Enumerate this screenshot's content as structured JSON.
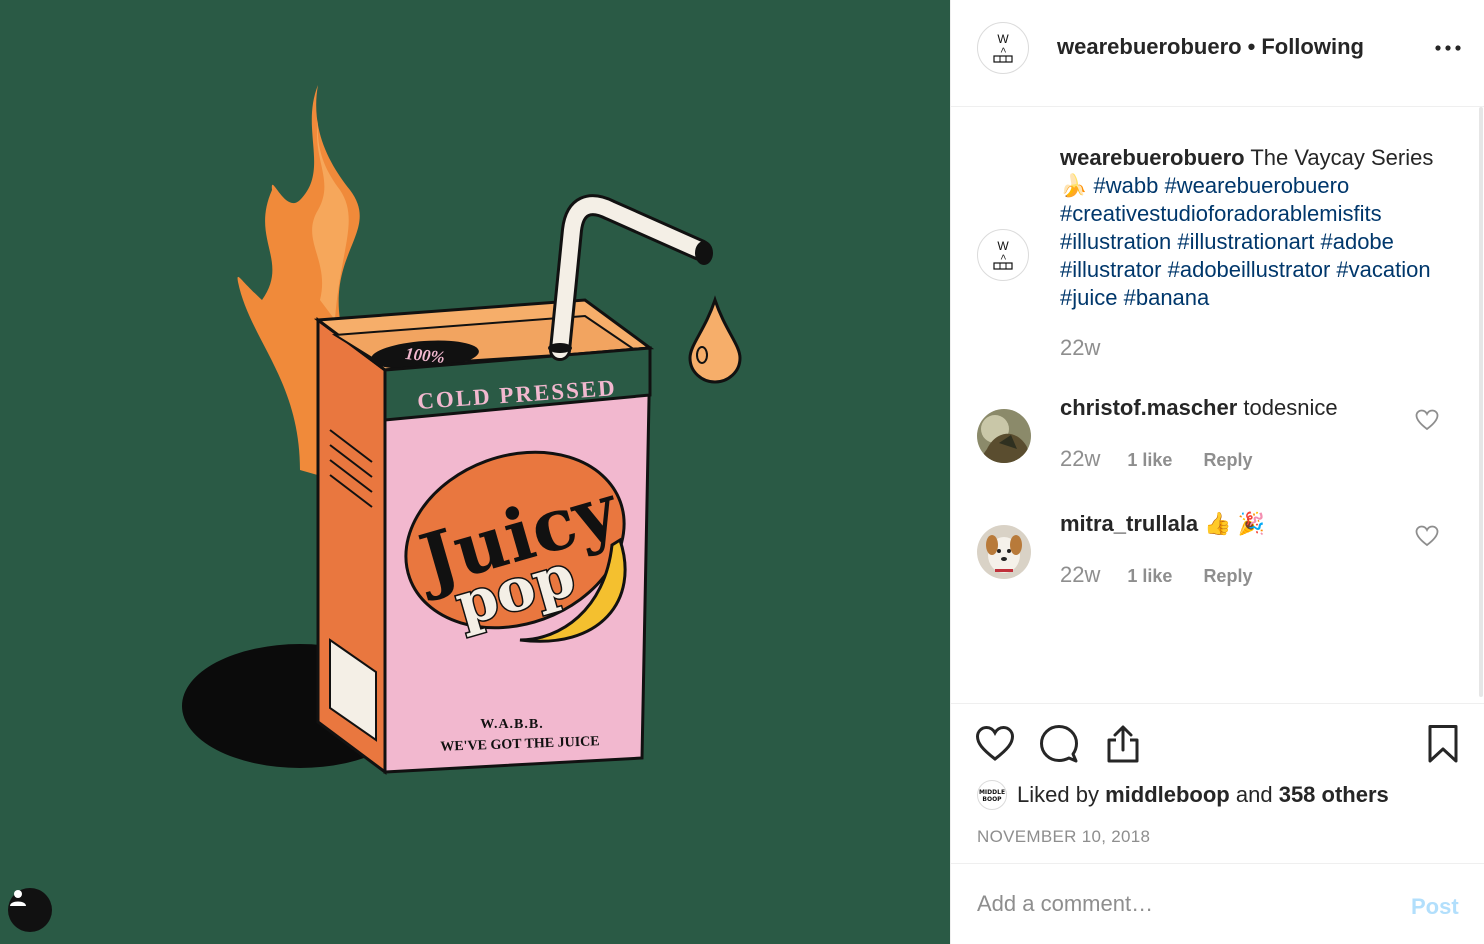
{
  "post_image": {
    "box_label_100": "100%",
    "box_label_cold_pressed": "COLD PRESSED",
    "brand_line1": "Juicy",
    "brand_line2": "pop",
    "maker": "W.A.B.B.",
    "slogan": "WE'VE GOT THE JUICE",
    "colors": {
      "background": "#2a5a45",
      "box_pink": "#f2b8cf",
      "box_orange": "#e9773f",
      "flame": "#f08a3a",
      "banana": "#f4c02f"
    }
  },
  "header": {
    "username": "wearebuerobuero",
    "separator": "•",
    "follow_status": "Following",
    "avatar_text": "W"
  },
  "caption": {
    "username": "wearebuerobuero",
    "text_before": "The Vaycay Series 🍌",
    "hashtags": [
      "#wabb",
      "#wearebuerobuero",
      "#creativestudioforadorablemisfits",
      "#illustration",
      "#illustrationart",
      "#adobe",
      "#illustrator",
      "#adobeillustrator",
      "#vacation",
      "#juice",
      "#banana"
    ],
    "time": "22w"
  },
  "comments": [
    {
      "username": "christof.mascher",
      "text": "todesnice",
      "time": "22w",
      "likes": "1 like",
      "reply": "Reply"
    },
    {
      "username": "mitra_trullala",
      "text": "👍 🎉",
      "time": "22w",
      "likes": "1 like",
      "reply": "Reply"
    }
  ],
  "actions": {
    "liked_by_prefix": "Liked by",
    "liked_by_user": "middleboop",
    "liked_by_and": "and",
    "liked_by_others": "358 others",
    "liker_avatar_text": "MIDDLE BOOP",
    "date": "NOVEMBER 10, 2018",
    "icons": [
      "heart-icon",
      "comment-icon",
      "share-icon",
      "bookmark-icon"
    ]
  },
  "add_comment": {
    "placeholder": "Add a comment…",
    "post_label": "Post"
  }
}
